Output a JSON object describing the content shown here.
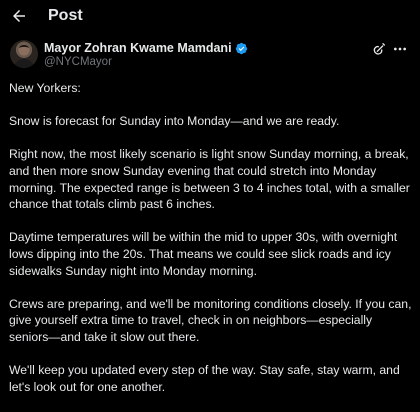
{
  "header": {
    "title": "Post"
  },
  "author": {
    "name": "Mayor Zohran Kwame Mamdani",
    "handle": "@NYCMayor"
  },
  "icons": {
    "back": "arrow-left-icon",
    "verified": "verified-badge-icon",
    "grok": "grok-icon",
    "more": "more-horizontal-icon"
  },
  "colors": {
    "background": "#000000",
    "text": "#e7e9ea",
    "muted": "#71767b",
    "verified": "#1d9bf0"
  },
  "post": {
    "paragraphs": [
      "New Yorkers:",
      "Snow is forecast for Sunday into Monday—and we are ready.",
      "Right now, the most likely scenario is light snow Sunday morning, a break, and then more snow Sunday evening that could stretch into Monday morning. The expected range is between 3 to 4 inches total, with a smaller chance that totals climb past 6 inches.",
      "Daytime temperatures will be within the mid to upper 30s, with overnight lows dipping into the 20s. That means we could see slick roads and icy sidewalks Sunday night into Monday morning.",
      "Crews are preparing, and we'll be monitoring conditions closely. If you can, give yourself extra time to travel, check in on neighbors—especially seniors—and take it slow out there.",
      "We'll keep you updated every step of the way. Stay safe, stay warm, and let's look out for one another."
    ]
  }
}
